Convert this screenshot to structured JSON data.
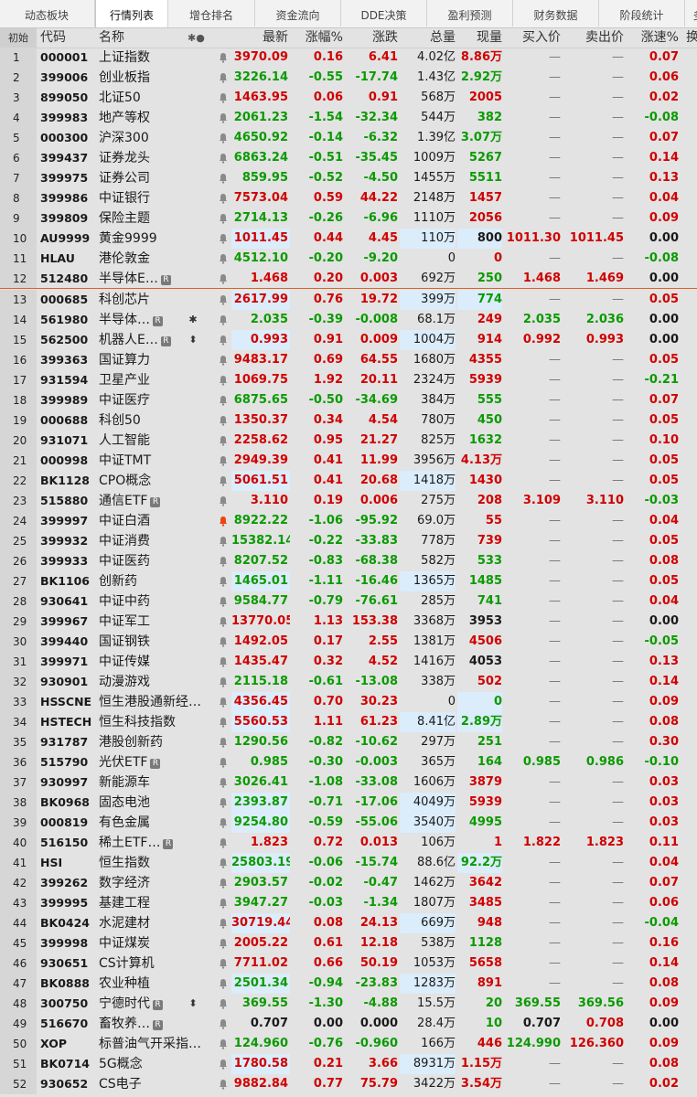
{
  "tabs": [
    "动态板块",
    "行情列表",
    "增仓排名",
    "资金流向",
    "DDE决策",
    "盈利预测",
    "财务数据",
    "阶段统计",
    "多"
  ],
  "active_tab": 1,
  "header": {
    "idx": "初始",
    "code": "代码",
    "name": "名称",
    "flag": "✱●",
    "price": "最新",
    "pct": "涨幅%",
    "chg": "涨跌",
    "vol": "总量",
    "cur": "现量",
    "bid": "买入价",
    "ask": "卖出价",
    "spd": "涨速%",
    "tail": "换"
  },
  "colors": {
    "up": "#d00000",
    "down": "#0a9a00",
    "highlight": "#dbecfb",
    "separator": "#e06020"
  },
  "rows": [
    {
      "i": "1",
      "code": "000001",
      "name": "上证指数",
      "price": "3970.09",
      "pct": "0.16",
      "chg": "6.41",
      "vol": "4.02亿",
      "cur": "8.86万",
      "bid": "—",
      "ask": "—",
      "spd": "0.07",
      "d": "r",
      "cd": "r",
      "sd": "r",
      "hp": false,
      "hv": false,
      "hc": false
    },
    {
      "i": "2",
      "code": "399006",
      "name": "创业板指",
      "price": "3226.14",
      "pct": "-0.55",
      "chg": "-17.74",
      "vol": "1.43亿",
      "cur": "2.92万",
      "bid": "—",
      "ask": "—",
      "spd": "0.06",
      "d": "g",
      "cd": "g",
      "sd": "r",
      "hp": false,
      "hv": false,
      "hc": false
    },
    {
      "i": "3",
      "code": "899050",
      "name": "北证50",
      "price": "1463.95",
      "pct": "0.06",
      "chg": "0.91",
      "vol": "568万",
      "cur": "2005",
      "bid": "—",
      "ask": "—",
      "spd": "0.02",
      "d": "r",
      "cd": "r",
      "sd": "r",
      "hp": false,
      "hv": false,
      "hc": false
    },
    {
      "i": "4",
      "code": "399983",
      "name": "地产等权",
      "price": "2061.23",
      "pct": "-1.54",
      "chg": "-32.34",
      "vol": "544万",
      "cur": "382",
      "bid": "—",
      "ask": "—",
      "spd": "-0.08",
      "d": "g",
      "cd": "g",
      "sd": "g",
      "hp": false,
      "hv": false,
      "hc": false
    },
    {
      "i": "5",
      "code": "000300",
      "name": "沪深300",
      "price": "4650.92",
      "pct": "-0.14",
      "chg": "-6.32",
      "vol": "1.39亿",
      "cur": "3.07万",
      "bid": "—",
      "ask": "—",
      "spd": "0.07",
      "d": "g",
      "cd": "g",
      "sd": "r",
      "hp": false,
      "hv": false,
      "hc": false
    },
    {
      "i": "6",
      "code": "399437",
      "name": "证券龙头",
      "price": "6863.24",
      "pct": "-0.51",
      "chg": "-35.45",
      "vol": "1009万",
      "cur": "5267",
      "bid": "—",
      "ask": "—",
      "spd": "0.14",
      "d": "g",
      "cd": "g",
      "sd": "r",
      "hp": false,
      "hv": false,
      "hc": false
    },
    {
      "i": "7",
      "code": "399975",
      "name": "证券公司",
      "price": "859.95",
      "pct": "-0.52",
      "chg": "-4.50",
      "vol": "1455万",
      "cur": "5511",
      "bid": "—",
      "ask": "—",
      "spd": "0.13",
      "d": "g",
      "cd": "g",
      "sd": "r",
      "hp": false,
      "hv": false,
      "hc": false
    },
    {
      "i": "8",
      "code": "399986",
      "name": "中证银行",
      "price": "7573.04",
      "pct": "0.59",
      "chg": "44.22",
      "vol": "2148万",
      "cur": "1457",
      "bid": "—",
      "ask": "—",
      "spd": "0.04",
      "d": "r",
      "cd": "r",
      "sd": "r",
      "hp": false,
      "hv": false,
      "hc": false
    },
    {
      "i": "9",
      "code": "399809",
      "name": "保险主题",
      "price": "2714.13",
      "pct": "-0.26",
      "chg": "-6.96",
      "vol": "1110万",
      "cur": "2056",
      "bid": "—",
      "ask": "—",
      "spd": "0.09",
      "d": "g",
      "cd": "r",
      "sd": "r",
      "hp": false,
      "hv": false,
      "hc": false
    },
    {
      "i": "10",
      "code": "AU9999",
      "name": "黄金9999",
      "price": "1011.45",
      "pct": "0.44",
      "chg": "4.45",
      "vol": "110万",
      "cur": "800",
      "bid": "1011.30",
      "ask": "1011.45",
      "spd": "0.00",
      "d": "r",
      "cd": "b",
      "sd": "b",
      "bd": "r",
      "hp": true,
      "hv": true,
      "hc": true
    },
    {
      "i": "11",
      "code": "HLAU",
      "name": "港伦敦金",
      "price": "4512.10",
      "pct": "-0.20",
      "chg": "-9.20",
      "vol": "0",
      "cur": "0",
      "bid": "—",
      "ask": "—",
      "spd": "-0.08",
      "d": "g",
      "cd": "r",
      "sd": "g",
      "hp": false,
      "hv": false,
      "hc": false
    },
    {
      "i": "12",
      "code": "512480",
      "name": "半导体E…",
      "badge": "R",
      "price": "1.468",
      "pct": "0.20",
      "chg": "0.003",
      "vol": "692万",
      "cur": "250",
      "bid": "1.468",
      "ask": "1.469",
      "spd": "0.00",
      "d": "r",
      "cd": "g",
      "sd": "b",
      "bd": "r",
      "hp": false,
      "hv": false,
      "hc": false
    },
    {
      "i": "13",
      "code": "000685",
      "name": "科创芯片",
      "price": "2617.99",
      "pct": "0.76",
      "chg": "19.72",
      "vol": "399万",
      "cur": "774",
      "bid": "—",
      "ask": "—",
      "spd": "0.05",
      "d": "r",
      "cd": "g",
      "sd": "r",
      "hp": true,
      "hv": true,
      "hc": true
    },
    {
      "i": "14",
      "code": "561980",
      "name": "半导体…",
      "badge": "R",
      "ext": "✱",
      "price": "2.035",
      "pct": "-0.39",
      "chg": "-0.008",
      "vol": "68.1万",
      "cur": "249",
      "bid": "2.035",
      "ask": "2.036",
      "spd": "0.00",
      "d": "g",
      "cd": "r",
      "sd": "b",
      "bd": "g",
      "hp": false,
      "hv": false,
      "hc": false
    },
    {
      "i": "15",
      "code": "562500",
      "name": "机器人E…",
      "badge": "R",
      "ext": "⬍",
      "price": "0.993",
      "pct": "0.91",
      "chg": "0.009",
      "vol": "1004万",
      "cur": "914",
      "bid": "0.992",
      "ask": "0.993",
      "spd": "0.00",
      "d": "r",
      "cd": "r",
      "sd": "b",
      "bd": "r",
      "hp": true,
      "hv": true,
      "hc": false
    },
    {
      "i": "16",
      "code": "399363",
      "name": "国证算力",
      "price": "9483.17",
      "pct": "0.69",
      "chg": "64.55",
      "vol": "1680万",
      "cur": "4355",
      "bid": "—",
      "ask": "—",
      "spd": "0.05",
      "d": "r",
      "cd": "r",
      "sd": "r",
      "hp": false,
      "hv": false,
      "hc": false
    },
    {
      "i": "17",
      "code": "931594",
      "name": "卫星产业",
      "price": "1069.75",
      "pct": "1.92",
      "chg": "20.11",
      "vol": "2324万",
      "cur": "5939",
      "bid": "—",
      "ask": "—",
      "spd": "-0.21",
      "d": "r",
      "cd": "r",
      "sd": "g",
      "hp": false,
      "hv": false,
      "hc": false
    },
    {
      "i": "18",
      "code": "399989",
      "name": "中证医疗",
      "price": "6875.65",
      "pct": "-0.50",
      "chg": "-34.69",
      "vol": "384万",
      "cur": "555",
      "bid": "—",
      "ask": "—",
      "spd": "0.07",
      "d": "g",
      "cd": "g",
      "sd": "r",
      "hp": false,
      "hv": false,
      "hc": false
    },
    {
      "i": "19",
      "code": "000688",
      "name": "科创50",
      "price": "1350.37",
      "pct": "0.34",
      "chg": "4.54",
      "vol": "780万",
      "cur": "450",
      "bid": "—",
      "ask": "—",
      "spd": "0.05",
      "d": "r",
      "cd": "g",
      "sd": "r",
      "hp": false,
      "hv": false,
      "hc": false
    },
    {
      "i": "20",
      "code": "931071",
      "name": "人工智能",
      "price": "2258.62",
      "pct": "0.95",
      "chg": "21.27",
      "vol": "825万",
      "cur": "1632",
      "bid": "—",
      "ask": "—",
      "spd": "0.10",
      "d": "r",
      "cd": "g",
      "sd": "r",
      "hp": false,
      "hv": false,
      "hc": false
    },
    {
      "i": "21",
      "code": "000998",
      "name": "中证TMT",
      "price": "2949.39",
      "pct": "0.41",
      "chg": "11.99",
      "vol": "3956万",
      "cur": "4.13万",
      "bid": "—",
      "ask": "—",
      "spd": "0.05",
      "d": "r",
      "cd": "r",
      "sd": "r",
      "hp": false,
      "hv": false,
      "hc": false
    },
    {
      "i": "22",
      "code": "BK1128",
      "name": "CPO概念",
      "price": "5061.51",
      "pct": "0.41",
      "chg": "20.68",
      "vol": "1418万",
      "cur": "1430",
      "bid": "—",
      "ask": "—",
      "spd": "0.05",
      "d": "r",
      "cd": "r",
      "sd": "r",
      "hp": true,
      "hv": true,
      "hc": false
    },
    {
      "i": "23",
      "code": "515880",
      "name": "通信ETF",
      "badge": "R",
      "price": "3.110",
      "pct": "0.19",
      "chg": "0.006",
      "vol": "275万",
      "cur": "208",
      "bid": "3.109",
      "ask": "3.110",
      "spd": "-0.03",
      "d": "r",
      "cd": "r",
      "sd": "g",
      "bd": "r",
      "hp": false,
      "hv": false,
      "hc": false
    },
    {
      "i": "24",
      "code": "399997",
      "name": "中证白酒",
      "price": "8922.22",
      "pct": "-1.06",
      "chg": "-95.92",
      "vol": "69.0万",
      "cur": "55",
      "bid": "—",
      "ask": "—",
      "spd": "0.04",
      "d": "g",
      "cd": "r",
      "sd": "r",
      "hp": false,
      "hv": false,
      "hc": false,
      "alert": true
    },
    {
      "i": "25",
      "code": "399932",
      "name": "中证消费",
      "price": "15382.14",
      "pct": "-0.22",
      "chg": "-33.83",
      "vol": "778万",
      "cur": "739",
      "bid": "—",
      "ask": "—",
      "spd": "0.05",
      "d": "g",
      "cd": "r",
      "sd": "r",
      "hp": false,
      "hv": false,
      "hc": false
    },
    {
      "i": "26",
      "code": "399933",
      "name": "中证医药",
      "price": "8207.52",
      "pct": "-0.83",
      "chg": "-68.38",
      "vol": "582万",
      "cur": "533",
      "bid": "—",
      "ask": "—",
      "spd": "0.08",
      "d": "g",
      "cd": "g",
      "sd": "r",
      "hp": false,
      "hv": false,
      "hc": false
    },
    {
      "i": "27",
      "code": "BK1106",
      "name": "创新药",
      "price": "1465.01",
      "pct": "-1.11",
      "chg": "-16.46",
      "vol": "1365万",
      "cur": "1485",
      "bid": "—",
      "ask": "—",
      "spd": "0.05",
      "d": "g",
      "cd": "g",
      "sd": "r",
      "hp": true,
      "hv": true,
      "hc": false
    },
    {
      "i": "28",
      "code": "930641",
      "name": "中证中药",
      "price": "9584.77",
      "pct": "-0.79",
      "chg": "-76.61",
      "vol": "285万",
      "cur": "741",
      "bid": "—",
      "ask": "—",
      "spd": "0.04",
      "d": "g",
      "cd": "g",
      "sd": "r",
      "hp": false,
      "hv": false,
      "hc": false
    },
    {
      "i": "29",
      "code": "399967",
      "name": "中证军工",
      "price": "13770.05",
      "pct": "1.13",
      "chg": "153.38",
      "vol": "3368万",
      "cur": "3953",
      "bid": "—",
      "ask": "—",
      "spd": "0.00",
      "d": "r",
      "cd": "b",
      "sd": "b",
      "hp": false,
      "hv": false,
      "hc": false
    },
    {
      "i": "30",
      "code": "399440",
      "name": "国证钢铁",
      "price": "1492.05",
      "pct": "0.17",
      "chg": "2.55",
      "vol": "1381万",
      "cur": "4506",
      "bid": "—",
      "ask": "—",
      "spd": "-0.05",
      "d": "r",
      "cd": "r",
      "sd": "g",
      "hp": false,
      "hv": false,
      "hc": false
    },
    {
      "i": "31",
      "code": "399971",
      "name": "中证传媒",
      "price": "1435.47",
      "pct": "0.32",
      "chg": "4.52",
      "vol": "1416万",
      "cur": "4053",
      "bid": "—",
      "ask": "—",
      "spd": "0.13",
      "d": "r",
      "cd": "b",
      "sd": "r",
      "hp": false,
      "hv": false,
      "hc": false
    },
    {
      "i": "32",
      "code": "930901",
      "name": "动漫游戏",
      "price": "2115.18",
      "pct": "-0.61",
      "chg": "-13.08",
      "vol": "338万",
      "cur": "502",
      "bid": "—",
      "ask": "—",
      "spd": "0.14",
      "d": "g",
      "cd": "r",
      "sd": "r",
      "hp": false,
      "hv": false,
      "hc": false
    },
    {
      "i": "33",
      "code": "HSSCNE",
      "name": "恒生港股通新经…",
      "price": "4356.45",
      "pct": "0.70",
      "chg": "30.23",
      "vol": "0",
      "cur": "0",
      "bid": "—",
      "ask": "—",
      "spd": "0.09",
      "d": "r",
      "cd": "g",
      "sd": "r",
      "hp": true,
      "hv": false,
      "hc": true
    },
    {
      "i": "34",
      "code": "HSTECH",
      "name": "恒生科技指数",
      "price": "5560.53",
      "pct": "1.11",
      "chg": "61.23",
      "vol": "8.41亿",
      "cur": "2.89万",
      "bid": "—",
      "ask": "—",
      "spd": "0.08",
      "d": "r",
      "cd": "g",
      "sd": "r",
      "hp": true,
      "hv": true,
      "hc": true
    },
    {
      "i": "35",
      "code": "931787",
      "name": "港股创新药",
      "price": "1290.56",
      "pct": "-0.82",
      "chg": "-10.62",
      "vol": "297万",
      "cur": "251",
      "bid": "—",
      "ask": "—",
      "spd": "0.30",
      "d": "g",
      "cd": "g",
      "sd": "r",
      "hp": false,
      "hv": false,
      "hc": false
    },
    {
      "i": "36",
      "code": "515790",
      "name": "光伏ETF",
      "badge": "R",
      "price": "0.985",
      "pct": "-0.30",
      "chg": "-0.003",
      "vol": "365万",
      "cur": "164",
      "bid": "0.985",
      "ask": "0.986",
      "spd": "-0.10",
      "d": "g",
      "cd": "g",
      "sd": "g",
      "bd": "g",
      "hp": false,
      "hv": false,
      "hc": false
    },
    {
      "i": "37",
      "code": "930997",
      "name": "新能源车",
      "price": "3026.41",
      "pct": "-1.08",
      "chg": "-33.08",
      "vol": "1606万",
      "cur": "3879",
      "bid": "—",
      "ask": "—",
      "spd": "0.03",
      "d": "g",
      "cd": "r",
      "sd": "r",
      "hp": false,
      "hv": false,
      "hc": false
    },
    {
      "i": "38",
      "code": "BK0968",
      "name": "固态电池",
      "price": "2393.87",
      "pct": "-0.71",
      "chg": "-17.06",
      "vol": "4049万",
      "cur": "5939",
      "bid": "—",
      "ask": "—",
      "spd": "0.03",
      "d": "g",
      "cd": "r",
      "sd": "r",
      "hp": true,
      "hv": true,
      "hc": false
    },
    {
      "i": "39",
      "code": "000819",
      "name": "有色金属",
      "price": "9254.80",
      "pct": "-0.59",
      "chg": "-55.06",
      "vol": "3540万",
      "cur": "4995",
      "bid": "—",
      "ask": "—",
      "spd": "0.03",
      "d": "g",
      "cd": "g",
      "sd": "r",
      "hp": true,
      "hv": true,
      "hc": false
    },
    {
      "i": "40",
      "code": "516150",
      "name": "稀土ETF…",
      "badge": "R",
      "price": "1.823",
      "pct": "0.72",
      "chg": "0.013",
      "vol": "106万",
      "cur": "1",
      "bid": "1.822",
      "ask": "1.823",
      "spd": "0.11",
      "d": "r",
      "cd": "r",
      "sd": "r",
      "bd": "r",
      "hp": false,
      "hv": false,
      "hc": false
    },
    {
      "i": "41",
      "code": "HSI",
      "name": "恒生指数",
      "price": "25803.19",
      "pct": "-0.06",
      "chg": "-15.74",
      "vol": "88.6亿",
      "cur": "92.2万",
      "bid": "—",
      "ask": "—",
      "spd": "0.04",
      "d": "g",
      "cd": "g",
      "sd": "r",
      "hp": true,
      "hv": false,
      "hc": true
    },
    {
      "i": "42",
      "code": "399262",
      "name": "数字经济",
      "price": "2903.57",
      "pct": "-0.02",
      "chg": "-0.47",
      "vol": "1462万",
      "cur": "3642",
      "bid": "—",
      "ask": "—",
      "spd": "0.07",
      "d": "g",
      "cd": "r",
      "sd": "r",
      "hp": false,
      "hv": false,
      "hc": false
    },
    {
      "i": "43",
      "code": "399995",
      "name": "基建工程",
      "price": "3947.27",
      "pct": "-0.03",
      "chg": "-1.34",
      "vol": "1807万",
      "cur": "3485",
      "bid": "—",
      "ask": "—",
      "spd": "0.06",
      "d": "g",
      "cd": "r",
      "sd": "r",
      "hp": false,
      "hv": false,
      "hc": false
    },
    {
      "i": "44",
      "code": "BK0424",
      "name": "水泥建材",
      "price": "30719.44",
      "pct": "0.08",
      "chg": "24.13",
      "vol": "669万",
      "cur": "948",
      "bid": "—",
      "ask": "—",
      "spd": "-0.04",
      "d": "r",
      "cd": "r",
      "sd": "g",
      "hp": true,
      "hv": true,
      "hc": false
    },
    {
      "i": "45",
      "code": "399998",
      "name": "中证煤炭",
      "price": "2005.22",
      "pct": "0.61",
      "chg": "12.18",
      "vol": "538万",
      "cur": "1128",
      "bid": "—",
      "ask": "—",
      "spd": "0.16",
      "d": "r",
      "cd": "g",
      "sd": "r",
      "hp": false,
      "hv": false,
      "hc": false
    },
    {
      "i": "46",
      "code": "930651",
      "name": "CS计算机",
      "price": "7711.02",
      "pct": "0.66",
      "chg": "50.19",
      "vol": "1053万",
      "cur": "5658",
      "bid": "—",
      "ask": "—",
      "spd": "0.14",
      "d": "r",
      "cd": "r",
      "sd": "r",
      "hp": false,
      "hv": false,
      "hc": false
    },
    {
      "i": "47",
      "code": "BK0888",
      "name": "农业种植",
      "price": "2501.34",
      "pct": "-0.94",
      "chg": "-23.83",
      "vol": "1283万",
      "cur": "891",
      "bid": "—",
      "ask": "—",
      "spd": "0.08",
      "d": "g",
      "cd": "r",
      "sd": "r",
      "hp": true,
      "hv": true,
      "hc": false
    },
    {
      "i": "48",
      "code": "300750",
      "name": "宁德时代",
      "badge": "R",
      "ext": "⬍",
      "price": "369.55",
      "pct": "-1.30",
      "chg": "-4.88",
      "vol": "15.5万",
      "cur": "20",
      "bid": "369.55",
      "ask": "369.56",
      "spd": "0.09",
      "d": "g",
      "cd": "g",
      "sd": "r",
      "bd": "g",
      "hp": false,
      "hv": false,
      "hc": false
    },
    {
      "i": "49",
      "code": "516670",
      "name": "畜牧养…",
      "badge": "R",
      "price": "0.707",
      "pct": "0.00",
      "chg": "0.000",
      "vol": "28.4万",
      "cur": "10",
      "bid": "0.707",
      "ask": "0.708",
      "spd": "0.00",
      "d": "b",
      "cd": "g",
      "sd": "b",
      "bd": "b",
      "ad": "r",
      "hp": false,
      "hv": false,
      "hc": false
    },
    {
      "i": "50",
      "code": "XOP",
      "name": "标普油气开采指…",
      "price": "124.960",
      "pct": "-0.76",
      "chg": "-0.960",
      "vol": "166万",
      "cur": "446",
      "bid": "124.990",
      "ask": "126.360",
      "spd": "0.09",
      "d": "g",
      "cd": "r",
      "sd": "r",
      "bd": "g",
      "ad": "r",
      "hp": false,
      "hv": false,
      "hc": false
    },
    {
      "i": "51",
      "code": "BK0714",
      "name": "5G概念",
      "price": "1780.58",
      "pct": "0.21",
      "chg": "3.66",
      "vol": "8931万",
      "cur": "1.15万",
      "bid": "—",
      "ask": "—",
      "spd": "0.08",
      "d": "r",
      "cd": "r",
      "sd": "r",
      "hp": true,
      "hv": true,
      "hc": false
    },
    {
      "i": "52",
      "code": "930652",
      "name": "CS电子",
      "price": "9882.84",
      "pct": "0.77",
      "chg": "75.79",
      "vol": "3422万",
      "cur": "3.54万",
      "bid": "—",
      "ask": "—",
      "spd": "0.02",
      "d": "r",
      "cd": "r",
      "sd": "r",
      "hp": false,
      "hv": false,
      "hc": false
    }
  ]
}
